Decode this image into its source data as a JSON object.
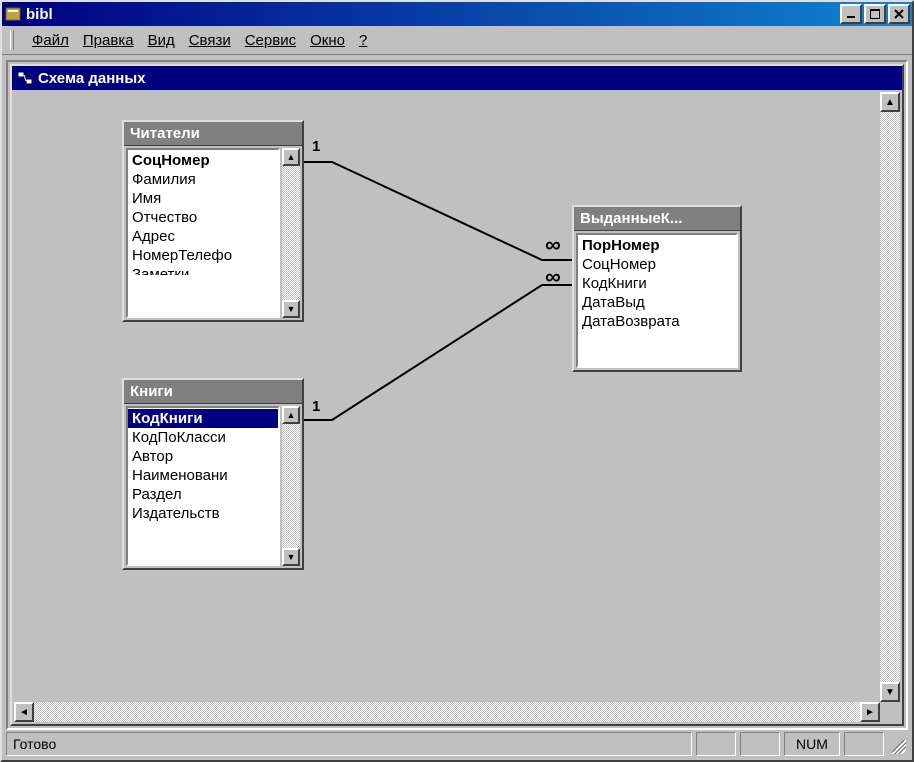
{
  "app": {
    "title": "bibl"
  },
  "menu": {
    "items": [
      {
        "label": "Файл",
        "hotkey_index": 0
      },
      {
        "label": "Правка",
        "hotkey_index": 0
      },
      {
        "label": "Вид",
        "hotkey_index": 0
      },
      {
        "label": "Связи",
        "hotkey_index": 0
      },
      {
        "label": "Сервис",
        "hotkey_index": 0
      },
      {
        "label": "Окно",
        "hotkey_index": 0
      },
      {
        "label": "?",
        "hotkey_index": 0
      }
    ]
  },
  "child_window": {
    "title": "Схема данных"
  },
  "tables": {
    "readers": {
      "title": "Читатели",
      "fields": [
        {
          "name": "СоцНомер",
          "is_key": true
        },
        {
          "name": "Фамилия"
        },
        {
          "name": "Имя"
        },
        {
          "name": "Отчество"
        },
        {
          "name": "Адрес"
        },
        {
          "name": "НомерТелефона",
          "display": "НомерТелефо"
        },
        {
          "name": "Заметки",
          "display": "Заметки",
          "partial": true
        }
      ],
      "has_scroll": true
    },
    "books": {
      "title": "Книги",
      "fields": [
        {
          "name": "КодКниги",
          "is_key": true,
          "selected": true
        },
        {
          "name": "КодПоКлассификатору",
          "display": "КодПоКласси"
        },
        {
          "name": "Автор"
        },
        {
          "name": "Наименование",
          "display": "Наименовани"
        },
        {
          "name": "Раздел"
        },
        {
          "name": "Издательство",
          "display": "Издательств"
        }
      ],
      "has_scroll": true
    },
    "loans": {
      "title_display": "ВыданныеК...",
      "title": "ВыданныеКниги",
      "fields": [
        {
          "name": "ПорНомер",
          "is_key": true
        },
        {
          "name": "СоцНомер"
        },
        {
          "name": "КодКниги"
        },
        {
          "name": "ДатаВыд"
        },
        {
          "name": "ДатаВозврата"
        }
      ],
      "has_scroll": false
    }
  },
  "relationships": [
    {
      "from_table": "readers",
      "from_field": "СоцНомер",
      "to_table": "loans",
      "to_field": "СоцНомер",
      "from_card": "1",
      "to_card": "∞"
    },
    {
      "from_table": "books",
      "from_field": "КодКниги",
      "to_table": "loans",
      "to_field": "КодКниги",
      "from_card": "1",
      "to_card": "∞"
    }
  ],
  "status": {
    "text": "Готово",
    "indicator": "NUM"
  }
}
